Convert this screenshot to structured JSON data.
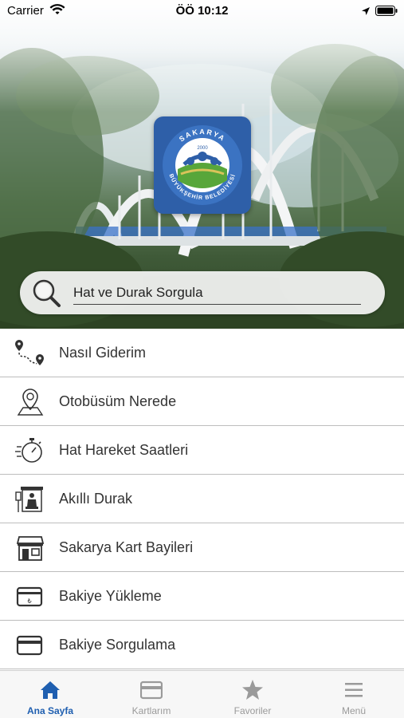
{
  "status_bar": {
    "carrier": "Carrier",
    "time": "ÖÖ 10:12"
  },
  "search": {
    "placeholder": "Hat ve Durak Sorgula"
  },
  "logo": {
    "top_text": "SAKARYA",
    "bottom_text": "BÜYÜKŞEHİR BELEDİYESİ",
    "year": "2000"
  },
  "menu": {
    "items": [
      {
        "label": "Nasıl Giderim",
        "icon": "route-pin-icon"
      },
      {
        "label": "Otobüsüm Nerede",
        "icon": "location-pin-icon"
      },
      {
        "label": "Hat Hareket Saatleri",
        "icon": "stopwatch-icon"
      },
      {
        "label": "Akıllı Durak",
        "icon": "bus-stop-icon"
      },
      {
        "label": "Sakarya Kart Bayileri",
        "icon": "store-icon"
      },
      {
        "label": "Bakiye Yükleme",
        "icon": "card-load-icon"
      },
      {
        "label": "Bakiye Sorgulama",
        "icon": "card-icon"
      }
    ]
  },
  "tabbar": {
    "tabs": [
      {
        "label": "Ana Sayfa",
        "icon": "home-icon",
        "active": true
      },
      {
        "label": "Kartlarım",
        "icon": "card-icon",
        "active": false
      },
      {
        "label": "Favoriler",
        "icon": "star-icon",
        "active": false
      },
      {
        "label": "Menü",
        "icon": "hamburger-icon",
        "active": false
      }
    ]
  },
  "colors": {
    "accent": "#1f5fb0",
    "inactive_tab": "#9a9a9a",
    "divider": "#bdbdbd",
    "logo_bg": "#2e5fa8"
  }
}
